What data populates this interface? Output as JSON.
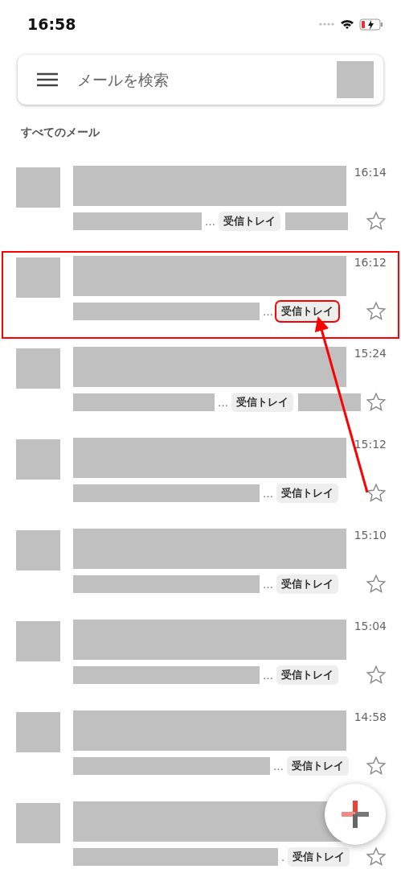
{
  "status_bar": {
    "time": "16:58"
  },
  "search": {
    "placeholder": "メールを検索"
  },
  "section_label": "すべてのメール",
  "rows": [
    {
      "time": "16:14",
      "ellipsis": "…",
      "tag": "受信トレイ",
      "trailing_block": true,
      "starred": false,
      "highlighted": false
    },
    {
      "time": "16:12",
      "ellipsis": "…",
      "tag": "受信トレイ",
      "trailing_block": false,
      "starred": false,
      "highlighted": true
    },
    {
      "time": "15:24",
      "ellipsis": "…",
      "tag": "受信トレイ",
      "trailing_block": true,
      "starred": false,
      "highlighted": false
    },
    {
      "time": "15:12",
      "ellipsis": "…",
      "tag": "受信トレイ",
      "trailing_block": false,
      "starred": false,
      "highlighted": false
    },
    {
      "time": "15:10",
      "ellipsis": "…",
      "tag": "受信トレイ",
      "trailing_block": false,
      "starred": false,
      "highlighted": false
    },
    {
      "time": "15:04",
      "ellipsis": "…",
      "tag": "受信トレイ",
      "trailing_block": false,
      "starred": false,
      "highlighted": false
    },
    {
      "time": "14:58",
      "ellipsis": "…",
      "tag": "受信トレイ",
      "trailing_block": false,
      "starred": false,
      "highlighted": false
    },
    {
      "ellipsis": ".",
      "tag": "受信トレイ",
      "trailing_block": false,
      "starred": false,
      "highlighted": false
    }
  ],
  "annotation": {
    "kind": "arrow"
  }
}
